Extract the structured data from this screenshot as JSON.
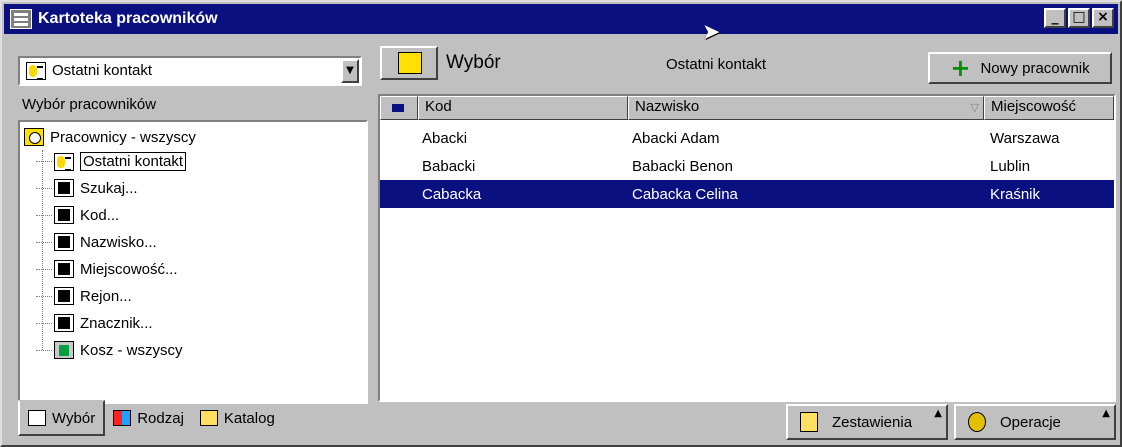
{
  "window": {
    "title": "Kartoteka pracowników",
    "buttons": {
      "minimize": "_",
      "maximize": "□",
      "close": "×"
    }
  },
  "left": {
    "combo_value": "Ostatni kontakt",
    "group_label": "Wybór pracowników",
    "tree": {
      "root": "Pracownicy - wszyscy",
      "items": [
        {
          "label": "Ostatni kontakt",
          "icon": "recent-contact-icon",
          "selected": true
        },
        {
          "label": "Szukaj...",
          "icon": "binoculars-icon"
        },
        {
          "label": "Kod...",
          "icon": "binoculars-icon"
        },
        {
          "label": "Nazwisko...",
          "icon": "binoculars-icon"
        },
        {
          "label": "Miejscowość...",
          "icon": "binoculars-icon"
        },
        {
          "label": "Rejon...",
          "icon": "binoculars-icon"
        },
        {
          "label": "Znacznik...",
          "icon": "binoculars-icon"
        },
        {
          "label": "Kosz - wszyscy",
          "icon": "trash-icon"
        }
      ]
    },
    "tabs": [
      {
        "label": "Wybór",
        "icon": "document-icon",
        "active": true
      },
      {
        "label": "Rodzaj",
        "icon": "categories-icon"
      },
      {
        "label": "Katalog",
        "icon": "folder-icon"
      }
    ]
  },
  "right": {
    "title": "Wybór",
    "subtitle": "Ostatni kontakt",
    "new_button": "Nowy pracownik",
    "columns": [
      "Kod",
      "Nazwisko",
      "Miejscowość"
    ],
    "sort_indicator": "▽",
    "rows": [
      {
        "kod": "Abacki",
        "nazwisko": "Abacki Adam",
        "miejscowosc": "Warszawa"
      },
      {
        "kod": "Babacki",
        "nazwisko": "Babacki Benon",
        "miejscowosc": "Lublin"
      },
      {
        "kod": "Cabacka",
        "nazwisko": "Cabacka Celina",
        "miejscowosc": "Kraśnik",
        "selected": true
      }
    ],
    "selected_row_index": 2,
    "bottom_buttons": [
      "Zestawienia",
      "Operacje"
    ]
  },
  "colors": {
    "titlebar": "#0a1080",
    "selection": "#0a1080",
    "face": "#c0c0c0",
    "plus": "#009000"
  }
}
